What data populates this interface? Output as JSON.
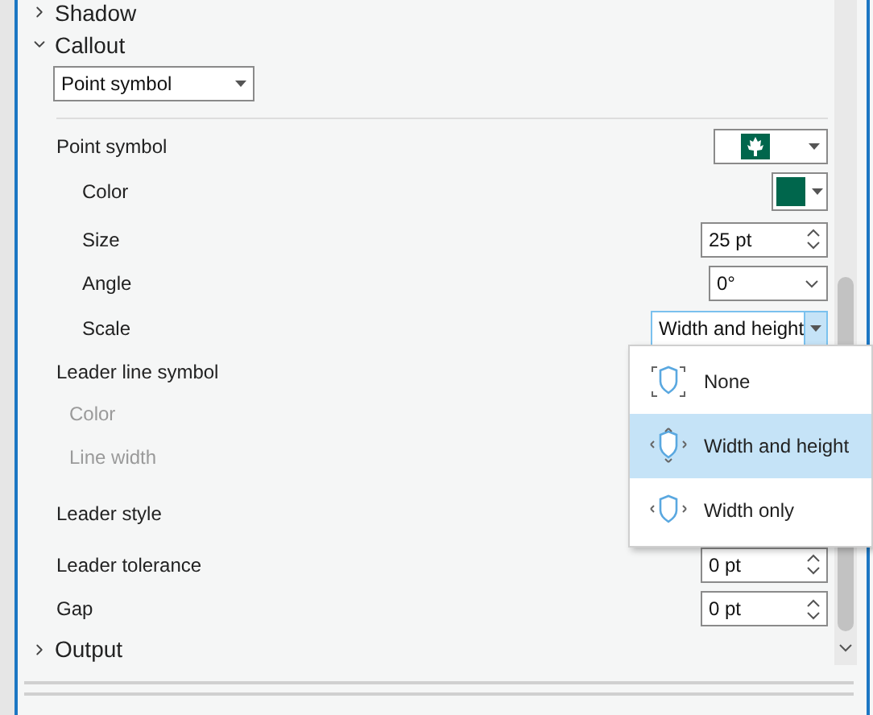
{
  "sections": [
    {
      "label": "Shadow",
      "expanded": false
    },
    {
      "label": "Callout",
      "expanded": true,
      "callout_type": "Point symbol",
      "properties": [
        {
          "label": "Point symbol",
          "kind": "symbol",
          "disabled": false,
          "children": [
            {
              "label": "Color",
              "kind": "color",
              "disabled": false,
              "color": "#00664c"
            },
            {
              "label": "Size",
              "kind": "spin",
              "disabled": false,
              "value": "25 pt"
            },
            {
              "label": "Angle",
              "kind": "dropdown",
              "disabled": false,
              "value": "0°"
            },
            {
              "label": "Scale",
              "kind": "combo",
              "disabled": false,
              "value": "Width and height"
            }
          ]
        },
        {
          "label": "Leader line symbol",
          "kind": "heading",
          "disabled": false,
          "children": [
            {
              "label": "Color",
              "kind": "heading",
              "disabled": true
            },
            {
              "label": "Line width",
              "kind": "heading",
              "disabled": true
            }
          ]
        },
        {
          "label": "Leader style",
          "kind": "heading",
          "disabled": false
        },
        {
          "label": "Leader tolerance",
          "kind": "spin",
          "disabled": false,
          "value": "0 pt"
        },
        {
          "label": "Gap",
          "kind": "spin",
          "disabled": false,
          "value": "0 pt"
        }
      ]
    },
    {
      "label": "Output",
      "expanded": false
    }
  ],
  "scale_menu": {
    "open": true,
    "options": [
      {
        "label": "None",
        "kind": "none",
        "selected": false
      },
      {
        "label": "Width and height",
        "kind": "both",
        "selected": true
      },
      {
        "label": "Width only",
        "kind": "width",
        "selected": false
      }
    ]
  }
}
